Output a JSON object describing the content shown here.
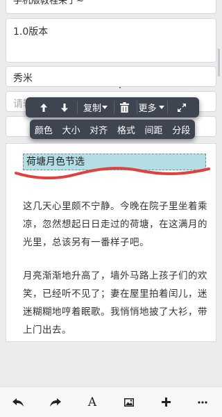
{
  "form": {
    "top_text": "手机版教程来了~",
    "description": "1.0版本",
    "author": "秀米",
    "input_placeholder": "请输"
  },
  "toolbar_primary": {
    "up_icon": "arrow-up-icon",
    "down_icon": "arrow-down-icon",
    "copy_label": "复制",
    "copy_dropdown_icon": "caret-down-icon",
    "delete_icon": "trash-icon",
    "more_label": "更多",
    "expand_icon": "expand-icon"
  },
  "toolbar_format": {
    "items": [
      "颜色",
      "大小",
      "对齐",
      "格式",
      "间距",
      "分段"
    ]
  },
  "editor": {
    "heading": "荷塘月色节选",
    "paragraphs": [
      "这几天心里颇不宁静。今晚在院子里坐着乘凉，忽然想起日日走过的荷塘，在这满月的光里，总该另有一番样子吧。",
      "月亮渐渐地升高了，墙外马路上孩子们的欢笑，已经听不见了；妻在屋里拍着闰儿，迷迷糊糊地哼着眠歌。我悄悄地披了大衫，带上门出去。"
    ],
    "annotation_color": "#e0413c"
  },
  "bottom_bar": {
    "undo_icon": "undo-icon",
    "redo_icon": "redo-icon",
    "font_label": "A",
    "image_icon": "image-icon",
    "add_icon": "plus-icon",
    "more_icon": "more-icon"
  }
}
